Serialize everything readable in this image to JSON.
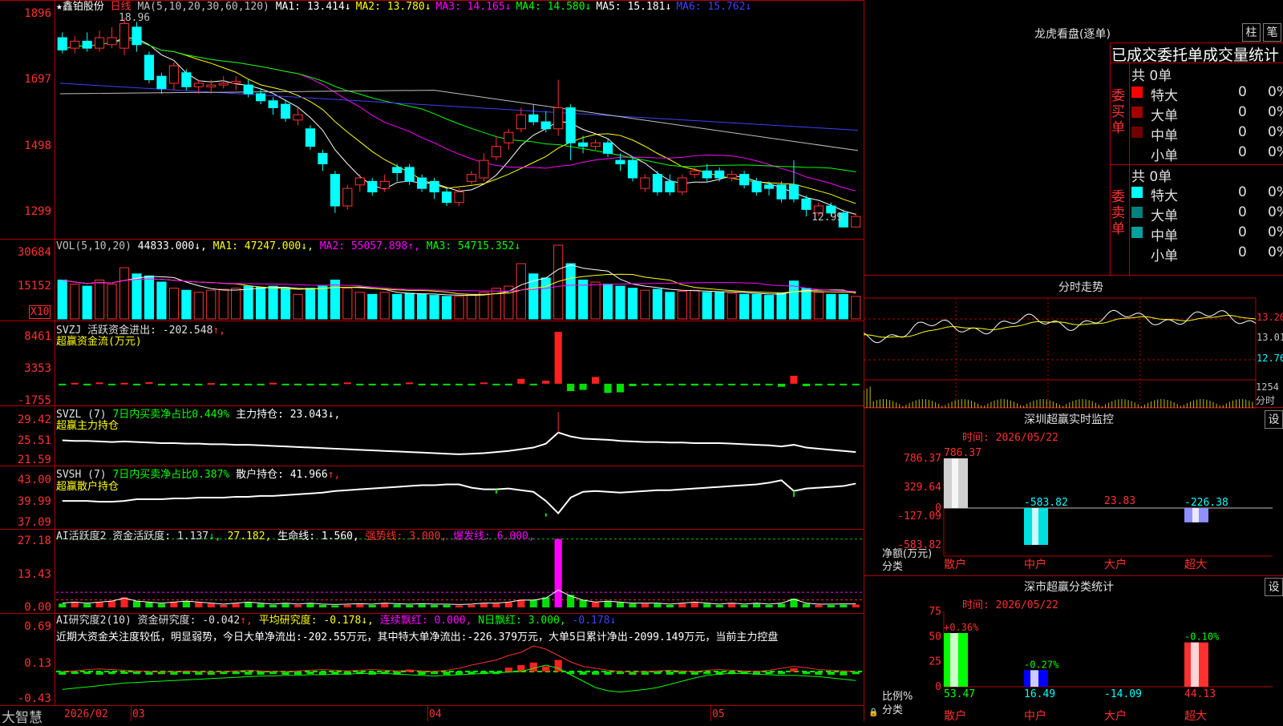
{
  "stock": {
    "name": "★鑫铂股份",
    "period": "日线"
  },
  "colors": {
    "up": "#ff3232",
    "down": "#00ffff",
    "ma1": "#ffffff",
    "ma2": "#ffff00",
    "ma3": "#ff00ff",
    "ma4": "#00ff00",
    "ma5": "#8080ff",
    "ma6": "#c0c0c0"
  },
  "main_panel": {
    "ma_label": "MA(5,10,20,30,60,120)",
    "ma_values": [
      {
        "label": "MA1: 13.414",
        "arrow": "↓",
        "color": "#ffffff"
      },
      {
        "label": "MA2: 13.780",
        "arrow": "↓",
        "color": "#ffff00"
      },
      {
        "label": "MA3: 14.165",
        "arrow": "↓",
        "color": "#ff00ff"
      },
      {
        "label": "MA4: 14.580",
        "arrow": "↓",
        "color": "#00ff00"
      },
      {
        "label": "MA5: 15.181",
        "arrow": "↓",
        "color": "#ffffff"
      },
      {
        "label": "MA6: 15.762",
        "arrow": "↓",
        "color": "#4040ff"
      }
    ],
    "y_ticks": [
      "1896",
      "1697",
      "1498",
      "1299"
    ],
    "high_label": "18.96",
    "low_label": "12.99"
  },
  "vol_panel": {
    "header": "VOL(5,10,20)",
    "vol": "44833.000↓,",
    "ma1": "MA1: 47247.000↓,",
    "ma2": "MA2: 55057.898↑,",
    "ma3": "MA3: 54715.352↓",
    "y_ticks": [
      "30684",
      "15152"
    ],
    "unit": "X10"
  },
  "svzj_panel": {
    "h1": "SVZJ  活跃资金进出: -202.548",
    "h1_arrow": "↑,",
    "h2": "超赢资金流(万元)",
    "y_ticks": [
      "8461",
      "3353",
      "-1755"
    ]
  },
  "svzl_panel": {
    "h_a": "SVZL (7)",
    "h_b": "7日内买卖净占比0.449%",
    "h_c": "主力持仓: 23.043↓,",
    "h2": "超赢主力持仓",
    "y_ticks": [
      "29.42",
      "25.51",
      "21.59"
    ]
  },
  "svsh_panel": {
    "h_a": "SVSH (7)",
    "h_b": "7日内买卖净占比0.387%",
    "h_c": "散户持仓: 41.966",
    "h_c_arrow": "↑,",
    "h2": "超赢散户持仓",
    "y_ticks": [
      "43.00",
      "39.99",
      "37.09"
    ]
  },
  "ai_panel": {
    "h_a": "AI活跃度2 资金活跃度: 1.137",
    "h_a_arrow": "↓,",
    "h_b": "27.182,",
    "h_c": "生命线: 1.560,",
    "h_d": "强势线: 3.000,",
    "h_e": "爆发线: 6.000,",
    "y_ticks": [
      "27.18",
      "13.43",
      "0.00"
    ]
  },
  "air_panel": {
    "h_a": "AI研究度2(10) 资金研究度: -0.042",
    "h_a_arrow": "↑,",
    "h_b": "平均研究度: -0.178↓,",
    "h_c": "连续飘红: 0.000,",
    "h_d": "N日飘红: 3.000,",
    "h_e": "-0.178↓",
    "commentary": "近期大资金关注度较低，明显弱势，今日大单净流出:-202.55万元，其中特大单净流出:-226.379万元，大单5日累计净出-2099.149万元，当前主力控盘",
    "y_ticks": [
      "0.69",
      "0.13",
      "-0.43"
    ]
  },
  "x_axis": {
    "labels": [
      "2026/02",
      "03",
      "04",
      "05"
    ]
  },
  "brand": "大智慧",
  "right": {
    "lhb_title": "龙虎看盘(逐单)",
    "btn_bar": "柱",
    "btn_pen": "笔",
    "stat_title": "已成交委托单成交量统计",
    "buy_label": "委买单",
    "sell_label": "委卖单",
    "buy_total": "共 0单",
    "sell_total": "共 0单",
    "buy_rows": [
      {
        "label": "特大",
        "count": "0",
        "pct": "0%",
        "color": "#ff0000"
      },
      {
        "label": "大单",
        "count": "0",
        "pct": "0%",
        "color": "#a00000"
      },
      {
        "label": "中单",
        "count": "0",
        "pct": "0%",
        "color": "#700000"
      },
      {
        "label": "小单",
        "count": "0",
        "pct": "0%",
        "color": ""
      }
    ],
    "sell_rows": [
      {
        "label": "特大",
        "count": "0",
        "pct": "0%",
        "color": "#00ffff"
      },
      {
        "label": "大单",
        "count": "0",
        "pct": "0%",
        "color": "#008080"
      },
      {
        "label": "中单",
        "count": "0",
        "pct": "0%",
        "color": "#00a0a0"
      },
      {
        "label": "小单",
        "count": "0",
        "pct": "0%",
        "color": ""
      }
    ],
    "intraday_title": "分时走势",
    "intraday_ticks": [
      "13.20",
      "13.01",
      "12.76"
    ],
    "intraday_vol": "1254",
    "intraday_vol_unit": "分时",
    "sz_monitor_title": "深圳超赢实时监控",
    "sz_set": "设",
    "sz_time": "时间: 2026/05/22",
    "sz_y_ticks": [
      "786.37",
      "329.64",
      "0",
      "-127.09",
      "-583.82"
    ],
    "sz_ylabel_a": "净额(万元)",
    "sz_ylabel_b": "分类",
    "sz_categories": [
      "散户",
      "中户",
      "大户",
      "超大"
    ],
    "sz_values": [
      786.37,
      -583.82,
      23.83,
      -226.38
    ],
    "sz_value_labels": [
      "786.37",
      "-583.82",
      "23.83",
      "-226.38"
    ],
    "sc_title": "深市超赢分类统计",
    "sc_set": "设",
    "sc_time": "时间: 2026/05/22",
    "sc_y_ticks": [
      "75",
      "50",
      "25",
      "0"
    ],
    "sc_ylabel_a": "比例%",
    "sc_ylabel_b": "分类",
    "sc_values": [
      53.47,
      16.49,
      -14.09,
      44.13
    ],
    "sc_value_labels": [
      "53.47",
      "16.49",
      "-14.09",
      "44.13"
    ],
    "sc_pct_labels": [
      "+0.36%",
      "-0.27%",
      "",
      "-0.10%"
    ],
    "sc_categories": [
      "散户",
      "中户",
      "大户",
      "超大"
    ]
  },
  "chart_data": [
    {
      "type": "candlestick",
      "title": "鑫铂股份 日线",
      "ylim": [
        12.8,
        19.2
      ],
      "y_ticks": [
        18.96,
        16.97,
        14.98,
        12.99
      ],
      "x_labels": [
        "2026/02",
        "03",
        "04",
        "05"
      ],
      "candles": [
        [
          18.4,
          18.05,
          18.55,
          17.95
        ],
        [
          18.1,
          18.3,
          18.45,
          17.95
        ],
        [
          18.3,
          18.1,
          18.55,
          18.0
        ],
        [
          18.1,
          18.4,
          18.6,
          18.0
        ],
        [
          18.2,
          18.4,
          18.7,
          18.1
        ],
        [
          18.1,
          18.8,
          18.96,
          17.9
        ],
        [
          18.7,
          18.2,
          18.85,
          18.0
        ],
        [
          17.9,
          17.2,
          18.0,
          17.1
        ],
        [
          17.3,
          16.95,
          17.4,
          16.8
        ],
        [
          17.1,
          17.6,
          17.7,
          16.9
        ],
        [
          17.4,
          17.0,
          17.5,
          16.9
        ],
        [
          17.0,
          17.1,
          17.2,
          16.8
        ],
        [
          17.0,
          17.05,
          17.2,
          16.8
        ],
        [
          17.05,
          17.1,
          17.3,
          16.95
        ],
        [
          17.1,
          17.15,
          17.3,
          16.9
        ],
        [
          17.05,
          16.8,
          17.2,
          16.7
        ],
        [
          16.8,
          16.6,
          16.95,
          16.5
        ],
        [
          16.6,
          16.4,
          16.7,
          16.2
        ],
        [
          16.5,
          16.1,
          16.6,
          16.0
        ],
        [
          16.05,
          16.2,
          16.4,
          15.9
        ],
        [
          15.8,
          15.3,
          15.9,
          15.2
        ],
        [
          15.1,
          14.8,
          15.2,
          14.6
        ],
        [
          14.5,
          13.6,
          14.6,
          13.4
        ],
        [
          13.6,
          14.1,
          14.2,
          13.5
        ],
        [
          14.2,
          14.4,
          14.5,
          14.0
        ],
        [
          14.3,
          14.0,
          14.4,
          13.9
        ],
        [
          14.1,
          14.3,
          14.5,
          14.0
        ],
        [
          14.7,
          14.55,
          14.8,
          14.3
        ],
        [
          14.7,
          14.3,
          14.8,
          14.2
        ],
        [
          14.4,
          14.1,
          14.5,
          14.0
        ],
        [
          14.3,
          14.0,
          14.4,
          13.8
        ],
        [
          14.0,
          13.7,
          14.1,
          13.6
        ],
        [
          13.7,
          14.0,
          14.1,
          13.6
        ],
        [
          14.3,
          14.5,
          14.6,
          14.2
        ],
        [
          14.4,
          14.9,
          15.1,
          14.3
        ],
        [
          15.0,
          15.3,
          15.6,
          14.9
        ],
        [
          15.4,
          15.7,
          15.8,
          15.2
        ],
        [
          15.8,
          16.2,
          16.4,
          15.7
        ],
        [
          16.2,
          16.0,
          16.5,
          15.9
        ],
        [
          16.0,
          15.8,
          16.3,
          15.7
        ],
        [
          15.8,
          16.4,
          17.2,
          15.6
        ],
        [
          16.4,
          15.4,
          16.5,
          14.9
        ],
        [
          15.4,
          15.3,
          15.6,
          15.1
        ],
        [
          15.3,
          15.4,
          15.5,
          15.2
        ],
        [
          15.4,
          15.1,
          15.5,
          15.0
        ],
        [
          14.9,
          14.8,
          15.1,
          14.6
        ],
        [
          14.9,
          14.4,
          15.0,
          14.3
        ],
        [
          14.1,
          14.4,
          14.5,
          14.0
        ],
        [
          14.5,
          14.0,
          14.6,
          13.9
        ],
        [
          14.3,
          14.0,
          14.5,
          13.9
        ],
        [
          14.0,
          14.4,
          14.5,
          13.9
        ],
        [
          14.5,
          14.6,
          14.7,
          14.4
        ],
        [
          14.6,
          14.4,
          14.8,
          14.3
        ],
        [
          14.6,
          14.4,
          14.7,
          14.3
        ],
        [
          14.4,
          14.5,
          14.6,
          14.3
        ],
        [
          14.5,
          14.2,
          14.6,
          14.1
        ],
        [
          14.3,
          14.0,
          14.4,
          13.9
        ],
        [
          14.2,
          14.1,
          14.3,
          13.9
        ],
        [
          14.2,
          13.8,
          14.3,
          13.7
        ],
        [
          14.2,
          13.8,
          14.9,
          13.7
        ],
        [
          13.8,
          13.5,
          13.9,
          13.3
        ],
        [
          13.4,
          13.6,
          13.7,
          13.3
        ],
        [
          13.6,
          13.4,
          13.7,
          13.3
        ],
        [
          13.4,
          13.0,
          13.5,
          12.99
        ],
        [
          13.0,
          13.3,
          13.4,
          12.99
        ]
      ]
    },
    {
      "type": "bar",
      "name": "VOL",
      "ylim": [
        0,
        36000
      ],
      "unit": "X10",
      "values": [
        19000,
        17000,
        16000,
        19000,
        17000,
        25000,
        22000,
        21000,
        18000,
        15000,
        14000,
        13000,
        14000,
        14500,
        15000,
        16000,
        15500,
        16000,
        15000,
        12000,
        15000,
        16000,
        19000,
        15000,
        13000,
        12000,
        13000,
        12000,
        12500,
        12000,
        11500,
        11000,
        11000,
        12000,
        13000,
        15000,
        16000,
        27000,
        22000,
        20000,
        36000,
        27000,
        19000,
        18000,
        17000,
        16000,
        15000,
        14000,
        14500,
        13000,
        13500,
        14000,
        13000,
        13000,
        12500,
        12000,
        12000,
        11500,
        12500,
        18500,
        15000,
        13000,
        12000,
        12000,
        11000
      ]
    },
    {
      "type": "bar",
      "name": "超赢资金流",
      "ylim": [
        -2500,
        9000
      ],
      "values": [
        -200,
        150,
        -200,
        200,
        -100,
        150,
        -200,
        250,
        -150,
        -200,
        -150,
        -200,
        100,
        -150,
        -200,
        -250,
        -200,
        150,
        -250,
        -200,
        -150,
        -250,
        -200,
        200,
        -200,
        -250,
        -200,
        -150,
        200,
        -150,
        -200,
        -200,
        -250,
        -150,
        200,
        -200,
        -200,
        800,
        -200,
        500,
        8461,
        -1200,
        -1000,
        1100,
        -1500,
        -1400,
        -400,
        -200,
        -300,
        -200,
        -250,
        -300,
        -250,
        -200,
        -150,
        -250,
        -200,
        -200,
        -500,
        1300,
        -400,
        -300,
        -250,
        -200,
        -200
      ]
    },
    {
      "type": "line",
      "name": "超赢主力持仓",
      "ylim": [
        21.0,
        30.5
      ],
      "values": [
        25.1,
        25.0,
        25.0,
        24.9,
        24.8,
        24.9,
        24.8,
        24.7,
        24.6,
        24.6,
        24.5,
        24.5,
        24.4,
        24.4,
        24.3,
        24.3,
        24.2,
        24.1,
        24.0,
        23.9,
        23.8,
        23.7,
        23.6,
        23.5,
        23.4,
        23.3,
        23.2,
        23.1,
        23.0,
        22.9,
        22.8,
        22.7,
        22.6,
        22.7,
        22.8,
        23.0,
        23.2,
        23.5,
        23.8,
        24.5,
        26.5,
        25.8,
        25.4,
        25.3,
        25.2,
        25.0,
        24.9,
        24.8,
        24.8,
        24.7,
        24.7,
        24.6,
        24.6,
        24.6,
        24.5,
        24.4,
        24.3,
        24.2,
        24.0,
        24.3,
        23.8,
        23.6,
        23.4,
        23.2,
        23.0
      ]
    },
    {
      "type": "line",
      "name": "超赢散户持仓",
      "ylim": [
        36.8,
        43.4
      ],
      "values": [
        39.8,
        39.8,
        39.8,
        39.7,
        39.7,
        39.8,
        40.0,
        40.0,
        40.0,
        40.1,
        40.1,
        40.2,
        40.2,
        40.2,
        40.3,
        40.3,
        40.4,
        40.4,
        40.5,
        40.6,
        40.7,
        40.8,
        41.0,
        41.1,
        41.2,
        41.3,
        41.4,
        41.5,
        41.6,
        41.7,
        41.7,
        41.8,
        41.8,
        41.4,
        41.2,
        41.2,
        41.3,
        41.1,
        40.9,
        39.8,
        38.3,
        40.2,
        40.9,
        41.0,
        40.9,
        40.8,
        40.9,
        41.0,
        41.1,
        41.1,
        41.2,
        41.3,
        41.4,
        41.5,
        41.6,
        41.7,
        41.8,
        42.0,
        42.3,
        41.0,
        41.3,
        41.4,
        41.5,
        41.6,
        41.9
      ]
    },
    {
      "type": "bar",
      "name": "AI活跃度2",
      "ylim": [
        0,
        28
      ],
      "values": [
        1.5,
        2.0,
        1.5,
        2.0,
        2.5,
        4.0,
        2.5,
        2.0,
        1.5,
        2.0,
        2.5,
        2.0,
        1.5,
        1.0,
        1.5,
        2.0,
        1.5,
        1.0,
        1.5,
        1.0,
        1.5,
        1.0,
        0.8,
        1.0,
        1.2,
        1.0,
        1.5,
        1.2,
        1.0,
        1.2,
        1.0,
        1.0,
        0.8,
        1.0,
        1.5,
        1.5,
        2.0,
        3.0,
        3.0,
        4.0,
        27.18,
        5.0,
        3.0,
        2.0,
        2.5,
        2.0,
        1.5,
        1.5,
        1.5,
        1.0,
        1.5,
        2.0,
        1.5,
        1.0,
        1.5,
        1.0,
        1.5,
        1.0,
        1.5,
        3.5,
        1.5,
        1.0,
        1.0,
        1.1,
        1.137
      ]
    },
    {
      "type": "bar",
      "name": "AI研究度2",
      "ylim": [
        -0.5,
        0.75
      ],
      "values": [
        -0.05,
        -0.04,
        -0.04,
        -0.05,
        -0.04,
        -0.03,
        -0.04,
        -0.05,
        -0.04,
        -0.05,
        -0.04,
        -0.05,
        -0.05,
        -0.04,
        -0.04,
        -0.05,
        -0.05,
        -0.04,
        -0.05,
        -0.05,
        -0.04,
        -0.05,
        -0.05,
        -0.05,
        -0.04,
        -0.05,
        -0.04,
        -0.05,
        0.03,
        -0.05,
        -0.04,
        -0.05,
        -0.05,
        -0.04,
        -0.04,
        -0.04,
        0.06,
        0.1,
        0.14,
        0.08,
        0.18,
        -0.04,
        -0.05,
        -0.05,
        -0.05,
        -0.04,
        -0.05,
        -0.05,
        -0.04,
        -0.05,
        -0.04,
        -0.05,
        -0.04,
        -0.05,
        -0.04,
        -0.04,
        -0.05,
        -0.04,
        -0.04,
        0.05,
        -0.04,
        -0.05,
        -0.05,
        -0.06,
        -0.042
      ]
    }
  ]
}
